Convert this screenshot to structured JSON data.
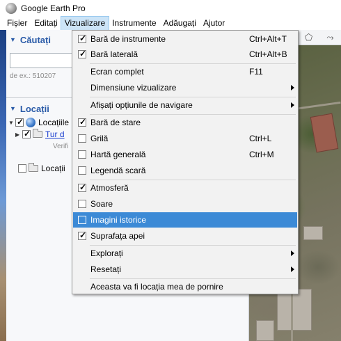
{
  "window": {
    "title": "Google Earth Pro"
  },
  "menubar": {
    "items": [
      "Fișier",
      "Editați",
      "Vizualizare",
      "Instrumente",
      "Adăugați",
      "Ajutor"
    ],
    "active": "Vizualizare"
  },
  "search_panel": {
    "header": "Căutați",
    "hint": "de ex.: 510207"
  },
  "places_panel": {
    "header": "Locații",
    "items": [
      {
        "label": "Locațiile",
        "checked": true,
        "expanded": true
      },
      {
        "label": "Tur d",
        "checked": true,
        "link": true
      },
      {
        "label": "Verifi",
        "sub": true
      },
      {
        "label": "Locații",
        "checked": false
      }
    ]
  },
  "dropdown": {
    "items": [
      {
        "label": "Bară de instrumente",
        "shortcut": "Ctrl+Alt+T",
        "checkbox": true,
        "checked": true
      },
      {
        "label": "Bară laterală",
        "shortcut": "Ctrl+Alt+B",
        "checkbox": true,
        "checked": true
      },
      {
        "separator": true
      },
      {
        "label": "Ecran complet",
        "shortcut": "F11"
      },
      {
        "label": "Dimensiune vizualizare",
        "submenu": true
      },
      {
        "separator": true
      },
      {
        "label": "Afișați opțiunile de navigare",
        "submenu": true
      },
      {
        "separator": true
      },
      {
        "label": "Bară de stare",
        "checkbox": true,
        "checked": true
      },
      {
        "label": "Grilă",
        "shortcut": "Ctrl+L",
        "checkbox": true,
        "checked": false
      },
      {
        "label": "Hartă generală",
        "shortcut": "Ctrl+M",
        "checkbox": true,
        "checked": false
      },
      {
        "label": "Legendă scară",
        "checkbox": true,
        "checked": false
      },
      {
        "separator": true
      },
      {
        "label": "Atmosferă",
        "checkbox": true,
        "checked": true
      },
      {
        "label": "Soare",
        "checkbox": true,
        "checked": false
      },
      {
        "label": "Imagini istorice",
        "checkbox": true,
        "checked": false,
        "highlighted": true
      },
      {
        "label": "Suprafața apei",
        "checkbox": true,
        "checked": true
      },
      {
        "separator": true
      },
      {
        "label": "Explorați",
        "submenu": true
      },
      {
        "label": "Resetați",
        "submenu": true
      },
      {
        "separator": true
      },
      {
        "label": "Aceasta va fi locația mea de pornire"
      }
    ]
  },
  "colors": {
    "highlight": "#3c8ad6",
    "panel_header": "#2a5ba8",
    "link": "#1a3ecf"
  },
  "icons": [
    "google-earth-logo-icon",
    "globe-icon",
    "folder-icon",
    "checkbox-icon",
    "submenu-arrow-icon",
    "polygon-tool-icon",
    "path-tool-icon"
  ]
}
